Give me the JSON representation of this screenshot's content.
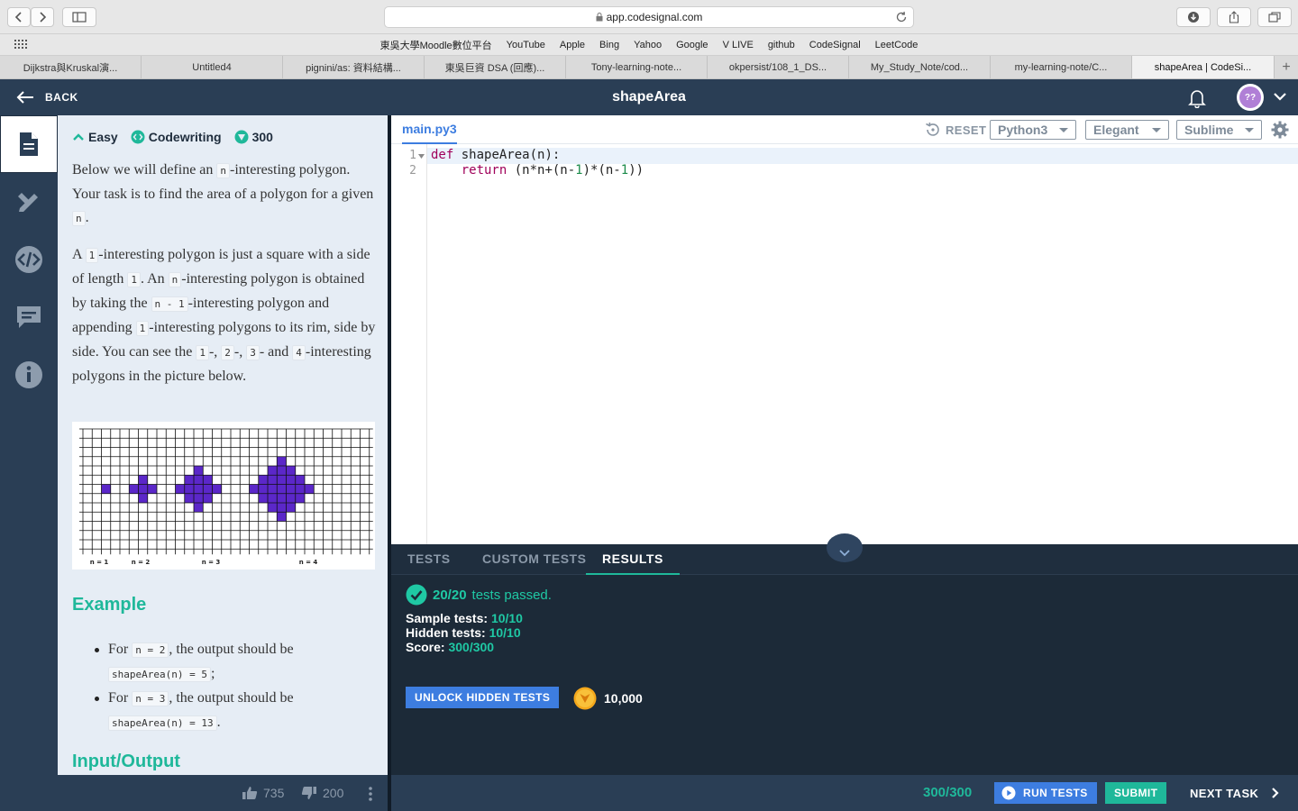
{
  "browser": {
    "url": "app.codesignal.com",
    "favorites": [
      "東吳大學Moodle數位平台",
      "YouTube",
      "Apple",
      "Bing",
      "Yahoo",
      "Google",
      "V LIVE",
      "github",
      "CodeSignal",
      "LeetCode"
    ],
    "tabs": [
      "Dijkstra與Kruskal演...",
      "Untitled4",
      "pignini/as: 資料結構...",
      "東吳巨資 DSA (回應)...",
      "Tony-learning-note...",
      "okpersist/108_1_DS...",
      "My_Study_Note/cod...",
      "my-learning-note/C...",
      "shapeArea | CodeSi..."
    ],
    "active_tab": 8
  },
  "header": {
    "back_label": "BACK",
    "title": "shapeArea",
    "avatar_text": "??"
  },
  "task": {
    "difficulty": "Easy",
    "type": "Codewriting",
    "points": "300",
    "p1": [
      "Below we will define an ",
      "n",
      "-interesting polygon. Your task is to find the area of a polygon for a given ",
      "n",
      "."
    ],
    "p2": [
      "A ",
      "1",
      "-interesting polygon is just a square with a side of length ",
      "1",
      ". An ",
      "n",
      "-interesting polygon is obtained by taking the ",
      "n - 1",
      "-interesting polygon and appending ",
      "1",
      "-interesting polygons to its rim, side by side. You can see the ",
      "1",
      "-, ",
      "2",
      "-, ",
      "3",
      "- and ",
      "4",
      "-interesting polygons in the picture below."
    ],
    "figure_labels": [
      "n = 1",
      "n = 2",
      "n = 3",
      "n = 4"
    ],
    "example_heading": "Example",
    "examples": [
      {
        "pre": "For ",
        "input": "n = 2",
        "mid": ", the output should be",
        "output": "shapeArea(n) = 5",
        "end": ";"
      },
      {
        "pre": "For ",
        "input": "n = 3",
        "mid": ", the output should be",
        "output": "shapeArea(n) = 13",
        "end": "."
      }
    ],
    "io_heading": "Input/Output",
    "likes": "735",
    "dislikes": "200"
  },
  "editor": {
    "file_tab": "main.py3",
    "reset_label": "RESET",
    "language": "Python3",
    "theme": "Elegant",
    "keymap": "Sublime",
    "line_numbers": [
      "1",
      "2"
    ],
    "code": {
      "l1_kw": "def",
      "l1_rest": " shapeArea(n):",
      "l2_indent": "    ",
      "l2_kw": "return",
      "l2_a": " (n*n+(n-",
      "l2_n1": "1",
      "l2_b": ")*(n-",
      "l2_n2": "1",
      "l2_c": "))"
    }
  },
  "results": {
    "tabs": [
      "TESTS",
      "CUSTOM TESTS",
      "RESULTS"
    ],
    "active_tab": 2,
    "passed": "20/20",
    "passed_suffix": "tests passed.",
    "sample_label": "Sample tests:",
    "sample_value": "10/10",
    "hidden_label": "Hidden tests:",
    "hidden_value": "10/10",
    "score_label": "Score:",
    "score_value": "300/300",
    "unlock_label": "UNLOCK HIDDEN TESTS",
    "coins": "10,000"
  },
  "footer": {
    "score": "300/300",
    "run_label": "RUN TESTS",
    "submit_label": "SUBMIT",
    "next_label": "NEXT TASK"
  },
  "colors": {
    "accent_green": "#1fb89a",
    "accent_blue": "#3d7de0",
    "header_bg": "#2a3e55",
    "polygon_fill": "#5b27c9"
  }
}
